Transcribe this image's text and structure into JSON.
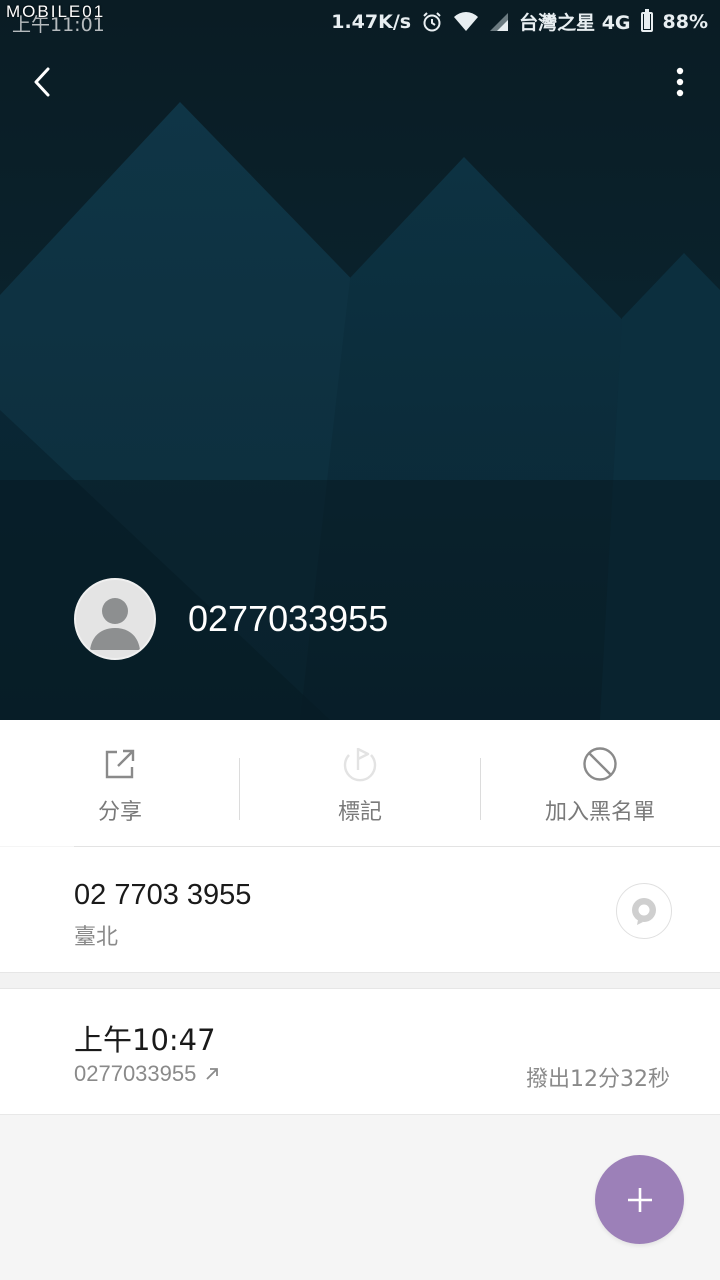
{
  "status_bar": {
    "watermark": "MOBILE01",
    "time": "上午11:01",
    "net_speed": "1.47K/s",
    "carrier": "台灣之星 4G",
    "battery": "88%",
    "battery_level": 0.88,
    "icons": [
      "alarm-icon",
      "wifi-icon",
      "signal-icon",
      "battery-icon"
    ]
  },
  "header": {
    "back_icon": "chevron-left-icon",
    "menu_icon": "more-vert-icon",
    "contact_name": "0277033955",
    "colors": {
      "bg_dark": "#0b2430",
      "mountain": "#0e3444"
    }
  },
  "actions": [
    {
      "label": "分享",
      "icon": "share-icon"
    },
    {
      "label": "標記",
      "icon": "flag-icon"
    },
    {
      "label": "加入黑名單",
      "icon": "block-icon"
    }
  ],
  "number_info": {
    "number": "02 7703 3955",
    "location": "臺北",
    "message_icon": "message-icon"
  },
  "call_log": [
    {
      "time": "上午10:47",
      "number": "0277033955",
      "direction_icon": "outgoing-call-icon",
      "detail": "撥出12分32秒"
    }
  ],
  "fab": {
    "icon": "plus-icon",
    "color": "#9c80b8"
  }
}
